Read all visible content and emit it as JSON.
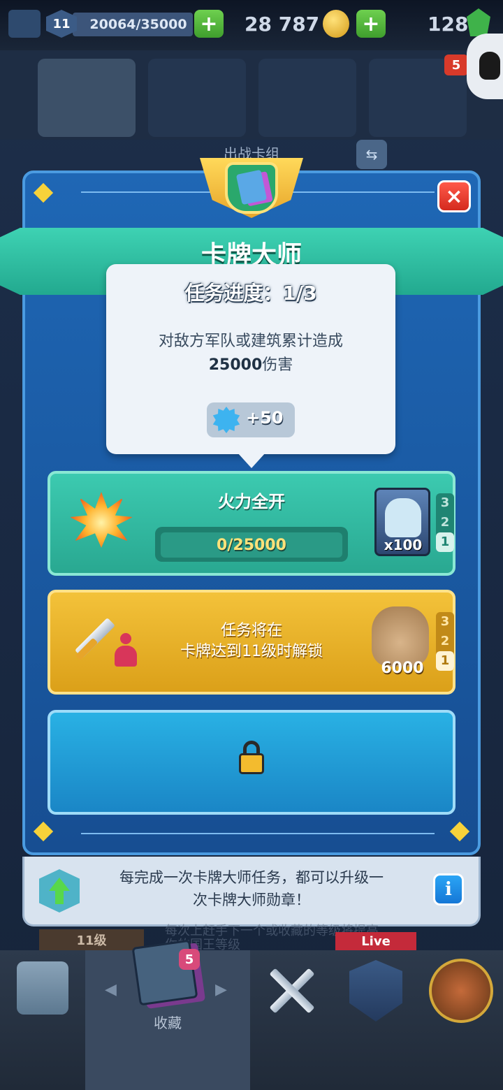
{
  "top_bar": {
    "level": "11",
    "xp": "20064/35000",
    "gold": "28 787",
    "gems": "128",
    "plus": "+"
  },
  "tabs": {
    "badge_count": "5"
  },
  "deck_title": "出战卡组",
  "modal": {
    "title": "卡牌大师",
    "close": "×",
    "tooltip": {
      "title": "任务进度：1/3",
      "desc_line1": "对敌方军队或建筑累计造成",
      "desc_value": "25000",
      "desc_suffix": "伤害",
      "reward": "+50"
    },
    "quests": [
      {
        "title": "火力全开",
        "progress": "0/25000",
        "progress_fraction": 0,
        "reward_count": "x100",
        "tiers": [
          "3",
          "2",
          "1"
        ]
      },
      {
        "line1": "任务将在",
        "line2": "卡牌达到11级时解锁",
        "reward_amount": "6000",
        "tiers": [
          "3",
          "2",
          "1"
        ]
      }
    ],
    "info_line1": "每完成一次卡牌大师任务，都可以升级一",
    "info_line2": "次卡牌大师勋章！",
    "info_button": "i"
  },
  "background": {
    "level_chip": "11级",
    "text1": "每次上赶手下一个或收藏的等级将提高",
    "text2": "你的国王等级",
    "live": "Live"
  },
  "bottom_nav": {
    "collection_label": "收藏",
    "collection_badge": "5",
    "arrow_left": "◀",
    "arrow_right": "▶"
  },
  "colors": {
    "modal_blue": "#1f67b5",
    "ribbon_teal": "#3ed2b3",
    "quest_gold": "#f3c23a",
    "close_red": "#ff5a4a",
    "progress_text": "#ffe27a"
  }
}
